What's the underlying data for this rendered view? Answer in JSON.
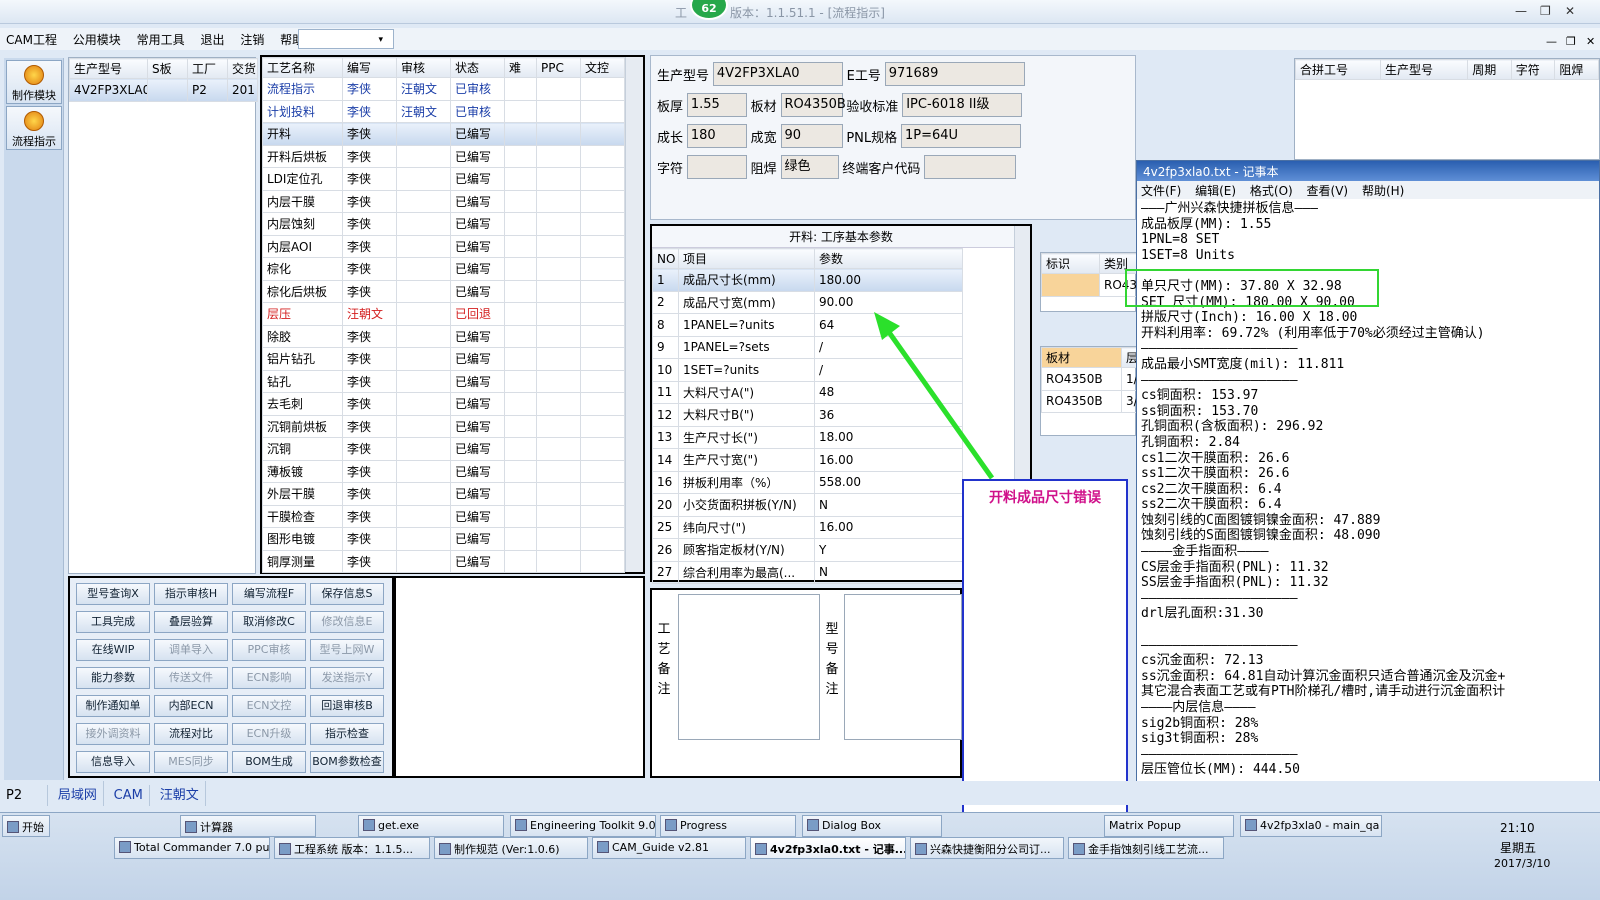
{
  "window": {
    "title": "工程系统  版本：1.1.51.1 - [流程指示]",
    "title_short": "工",
    "title_rest": "版本：1.1.51.1 - [流程指示]",
    "badge": "62",
    "min": "—",
    "restore": "❐",
    "close": "✕"
  },
  "menu": {
    "items": [
      "CAM工程",
      "公用模块",
      "常用工具",
      "退出",
      "注销",
      "帮助"
    ],
    "dropdown": "▾"
  },
  "sidebar": {
    "items": [
      {
        "label": "制作模块"
      },
      {
        "label": "流程指示"
      }
    ]
  },
  "model_list": {
    "headers": [
      "生产型号",
      "S板",
      "工厂",
      "交货"
    ],
    "rows": [
      [
        "4V2FP3XLA0",
        "",
        "P2",
        "201"
      ]
    ]
  },
  "process": {
    "headers": [
      "工艺名称",
      "编写",
      "审核",
      "状态",
      "难",
      "PPC",
      "文控"
    ],
    "rows": [
      [
        "流程指示",
        "李侠",
        "汪朝文",
        "已审核",
        "blue"
      ],
      [
        "计划投料",
        "李侠",
        "汪朝文",
        "已审核",
        "blue"
      ],
      [
        "开料",
        "李侠",
        "",
        "已编写",
        "sel"
      ],
      [
        "开料后烘板",
        "李侠",
        "",
        "已编写",
        ""
      ],
      [
        "LDI定位孔",
        "李侠",
        "",
        "已编写",
        ""
      ],
      [
        "内层干膜",
        "李侠",
        "",
        "已编写",
        ""
      ],
      [
        "内层蚀刻",
        "李侠",
        "",
        "已编写",
        ""
      ],
      [
        "内层AOI",
        "李侠",
        "",
        "已编写",
        ""
      ],
      [
        "棕化",
        "李侠",
        "",
        "已编写",
        ""
      ],
      [
        "棕化后烘板",
        "李侠",
        "",
        "已编写",
        ""
      ],
      [
        "层压",
        "汪朝文",
        "",
        "已回退",
        "red"
      ],
      [
        "除胶",
        "李侠",
        "",
        "已编写",
        ""
      ],
      [
        "铝片钻孔",
        "李侠",
        "",
        "已编写",
        ""
      ],
      [
        "钻孔",
        "李侠",
        "",
        "已编写",
        ""
      ],
      [
        "去毛刺",
        "李侠",
        "",
        "已编写",
        ""
      ],
      [
        "沉铜前烘板",
        "李侠",
        "",
        "已编写",
        ""
      ],
      [
        "沉铜",
        "李侠",
        "",
        "已编写",
        ""
      ],
      [
        "薄板镀",
        "李侠",
        "",
        "已编写",
        ""
      ],
      [
        "外层干膜",
        "李侠",
        "",
        "已编写",
        ""
      ],
      [
        "干膜检查",
        "李侠",
        "",
        "已编写",
        ""
      ],
      [
        "图形电镀",
        "李侠",
        "",
        "已编写",
        ""
      ],
      [
        "铜厚测量",
        "李侠",
        "",
        "已编写",
        ""
      ]
    ]
  },
  "buttons": [
    [
      "型号查询X",
      "指示审核H",
      "编写流程F",
      "保存信息S"
    ],
    [
      "工具完成",
      "叠层验算",
      "取消修改C",
      "修改信息E"
    ],
    [
      "在线WIP",
      "调单导入",
      "PPC审核",
      "型号上网W"
    ],
    [
      "能力参数",
      "传送文件",
      "ECN影响",
      "发送指示Y"
    ],
    [
      "制作通知单",
      "内部ECN",
      "ECN文控",
      "回退审核B"
    ],
    [
      "接外调资料",
      "流程对比",
      "ECN升级",
      "指示检查"
    ],
    [
      "信息导入",
      "MES同步",
      "BOM生成",
      "BOM参数检查"
    ]
  ],
  "buttons_disabled": [
    "修改信息E",
    "调单导入",
    "PPC审核",
    "型号上网W",
    "传送文件",
    "ECN影响",
    "发送指示Y",
    "ECN文控",
    "接外调资料",
    "ECN升级",
    "MES同步"
  ],
  "info": {
    "prod_model_label": "生产型号",
    "prod_model": "4V2FP3XLA0",
    "e_label": "E工号",
    "e_no": "971689",
    "thick_label": "板厚",
    "thick": "1.55",
    "mat_label": "板材",
    "mat": "RO4350B",
    "std_label": "验收标准",
    "std": "IPC-6018 II级",
    "len_label": "成长",
    "len": "180",
    "wid_label": "成宽",
    "wid": "90",
    "pnl_label": "PNL规格",
    "pnl": "1P=64U",
    "char_label": "字符",
    "char": "",
    "mask_label": "阻焊",
    "mask": "绿色",
    "cust_label": "终端客户代码",
    "cust": ""
  },
  "params": {
    "title": "开料: 工序基本参数",
    "headers": [
      "NO",
      "项目",
      "参数"
    ],
    "rows": [
      [
        "1",
        "成品尺寸长(mm)",
        "180.00"
      ],
      [
        "2",
        "成品尺寸宽(mm)",
        "90.00"
      ],
      [
        "8",
        "1PANEL=?units",
        "64"
      ],
      [
        "9",
        "1PANEL=?sets",
        "/"
      ],
      [
        "10",
        "1SET=?units",
        "/"
      ],
      [
        "11",
        "大料尺寸A(\")",
        "48"
      ],
      [
        "12",
        "大料尺寸B(\")",
        "36"
      ],
      [
        "13",
        "生产尺寸长(\")",
        "18.00"
      ],
      [
        "14",
        "生产尺寸宽(\")",
        "16.00"
      ],
      [
        "16",
        "拼板利用率（%）",
        "558.00"
      ],
      [
        "20",
        "小交货面积拼板(Y/N)",
        "N"
      ],
      [
        "25",
        "纬向尺寸(\")",
        "16.00"
      ],
      [
        "26",
        "顾客指定板材(Y/N)",
        "Y"
      ],
      [
        "27",
        "综合利用率为最高(...",
        "N"
      ]
    ]
  },
  "remarks": {
    "craft": "工艺备注",
    "model": "型号备注"
  },
  "merge": {
    "headers": [
      "合拼工号",
      "生产型号",
      "周期",
      "字符",
      "阻焊"
    ]
  },
  "mark": {
    "headers": [
      "标识",
      "类别"
    ],
    "rows": [
      [
        "",
        "RO43"
      ]
    ]
  },
  "mat_table": {
    "headers": [
      "板材",
      "层"
    ],
    "rows": [
      [
        "RO4350B",
        "1/"
      ],
      [
        "RO4350B",
        "3/"
      ]
    ]
  },
  "annotation": {
    "text": "开料成品尺寸错误"
  },
  "notepad": {
    "title": "4v2fp3xla0.txt - 记事本",
    "menu": [
      "文件(F)",
      "编辑(E)",
      "格式(O)",
      "查看(V)",
      "帮助(H)"
    ],
    "lines": [
      "———广州兴森快捷拼板信息———",
      "成品板厚(MM): 1.55",
      "1PNL=8 SET",
      "1SET=8 Units",
      "————————————————————",
      "单只尺寸(MM): 37.80 X 32.98",
      "SET 尺寸(MM): 180.00 X 90.00",
      "拼版尺寸(Inch): 16.00 X 18.00",
      "开料利用率: 69.72% (利用率低于70%必须经过主管确认)",
      "————————————————————",
      "成品最小SMT宽度(mil): 11.811",
      "————————————————————",
      "cs铜面积: 153.97",
      "ss铜面积: 153.70",
      "孔铜面积(含板面积): 296.92",
      "孔铜面积: 2.84",
      "cs1二次干膜面积: 26.6",
      "ss1二次干膜面积: 26.6",
      "cs2二次干膜面积: 6.4",
      "ss2二次干膜面积: 6.4",
      "蚀刻引线的C面图镀铜镍金面积: 47.889",
      "蚀刻引线的S面图镀铜镍金面积: 48.090",
      "————金手指面积————",
      "CS层金手指面积(PNL): 11.32",
      "SS层金手指面积(PNL): 11.32",
      "————————————————————",
      "drl层孔面积:31.30",
      "",
      "————————————————————",
      "cs沉金面积: 72.13",
      "ss沉金面积: 64.81自动计算沉金面积只适合普通沉金及沉金+",
      "其它混合表面工艺或有PTH阶梯孔/槽时,请手动进行沉金面积计",
      "————内层信息————",
      "sig2b铜面积: 28%",
      "sig3t铜面积: 28%",
      "————————————————————",
      "层压管位长(MM): 444.50"
    ]
  },
  "bottom_tabs": [
    "P2",
    "局域网",
    "CAM",
    "汪朝文"
  ],
  "taskbar": {
    "start": "开始",
    "row1": [
      "计算器",
      "get.exe",
      "Engineering Toolkit 9.0...",
      "Progress",
      "Dialog Box",
      "Matrix Popup",
      "4v2fp3xla0 - main_qa"
    ],
    "row2": [
      "Total Commander 7.0 pu...",
      "工程系统  版本：1.1.5...",
      "制作规范 (Ver:1.0.6)",
      "CAM_Guide v2.81",
      "4v2fp3xla0.txt - 记事...",
      "兴森快捷衡阳分公司订...",
      "金手指蚀刻引线工艺流..."
    ],
    "time": "21:10",
    "day": "星期五",
    "date": "2017/3/10"
  }
}
